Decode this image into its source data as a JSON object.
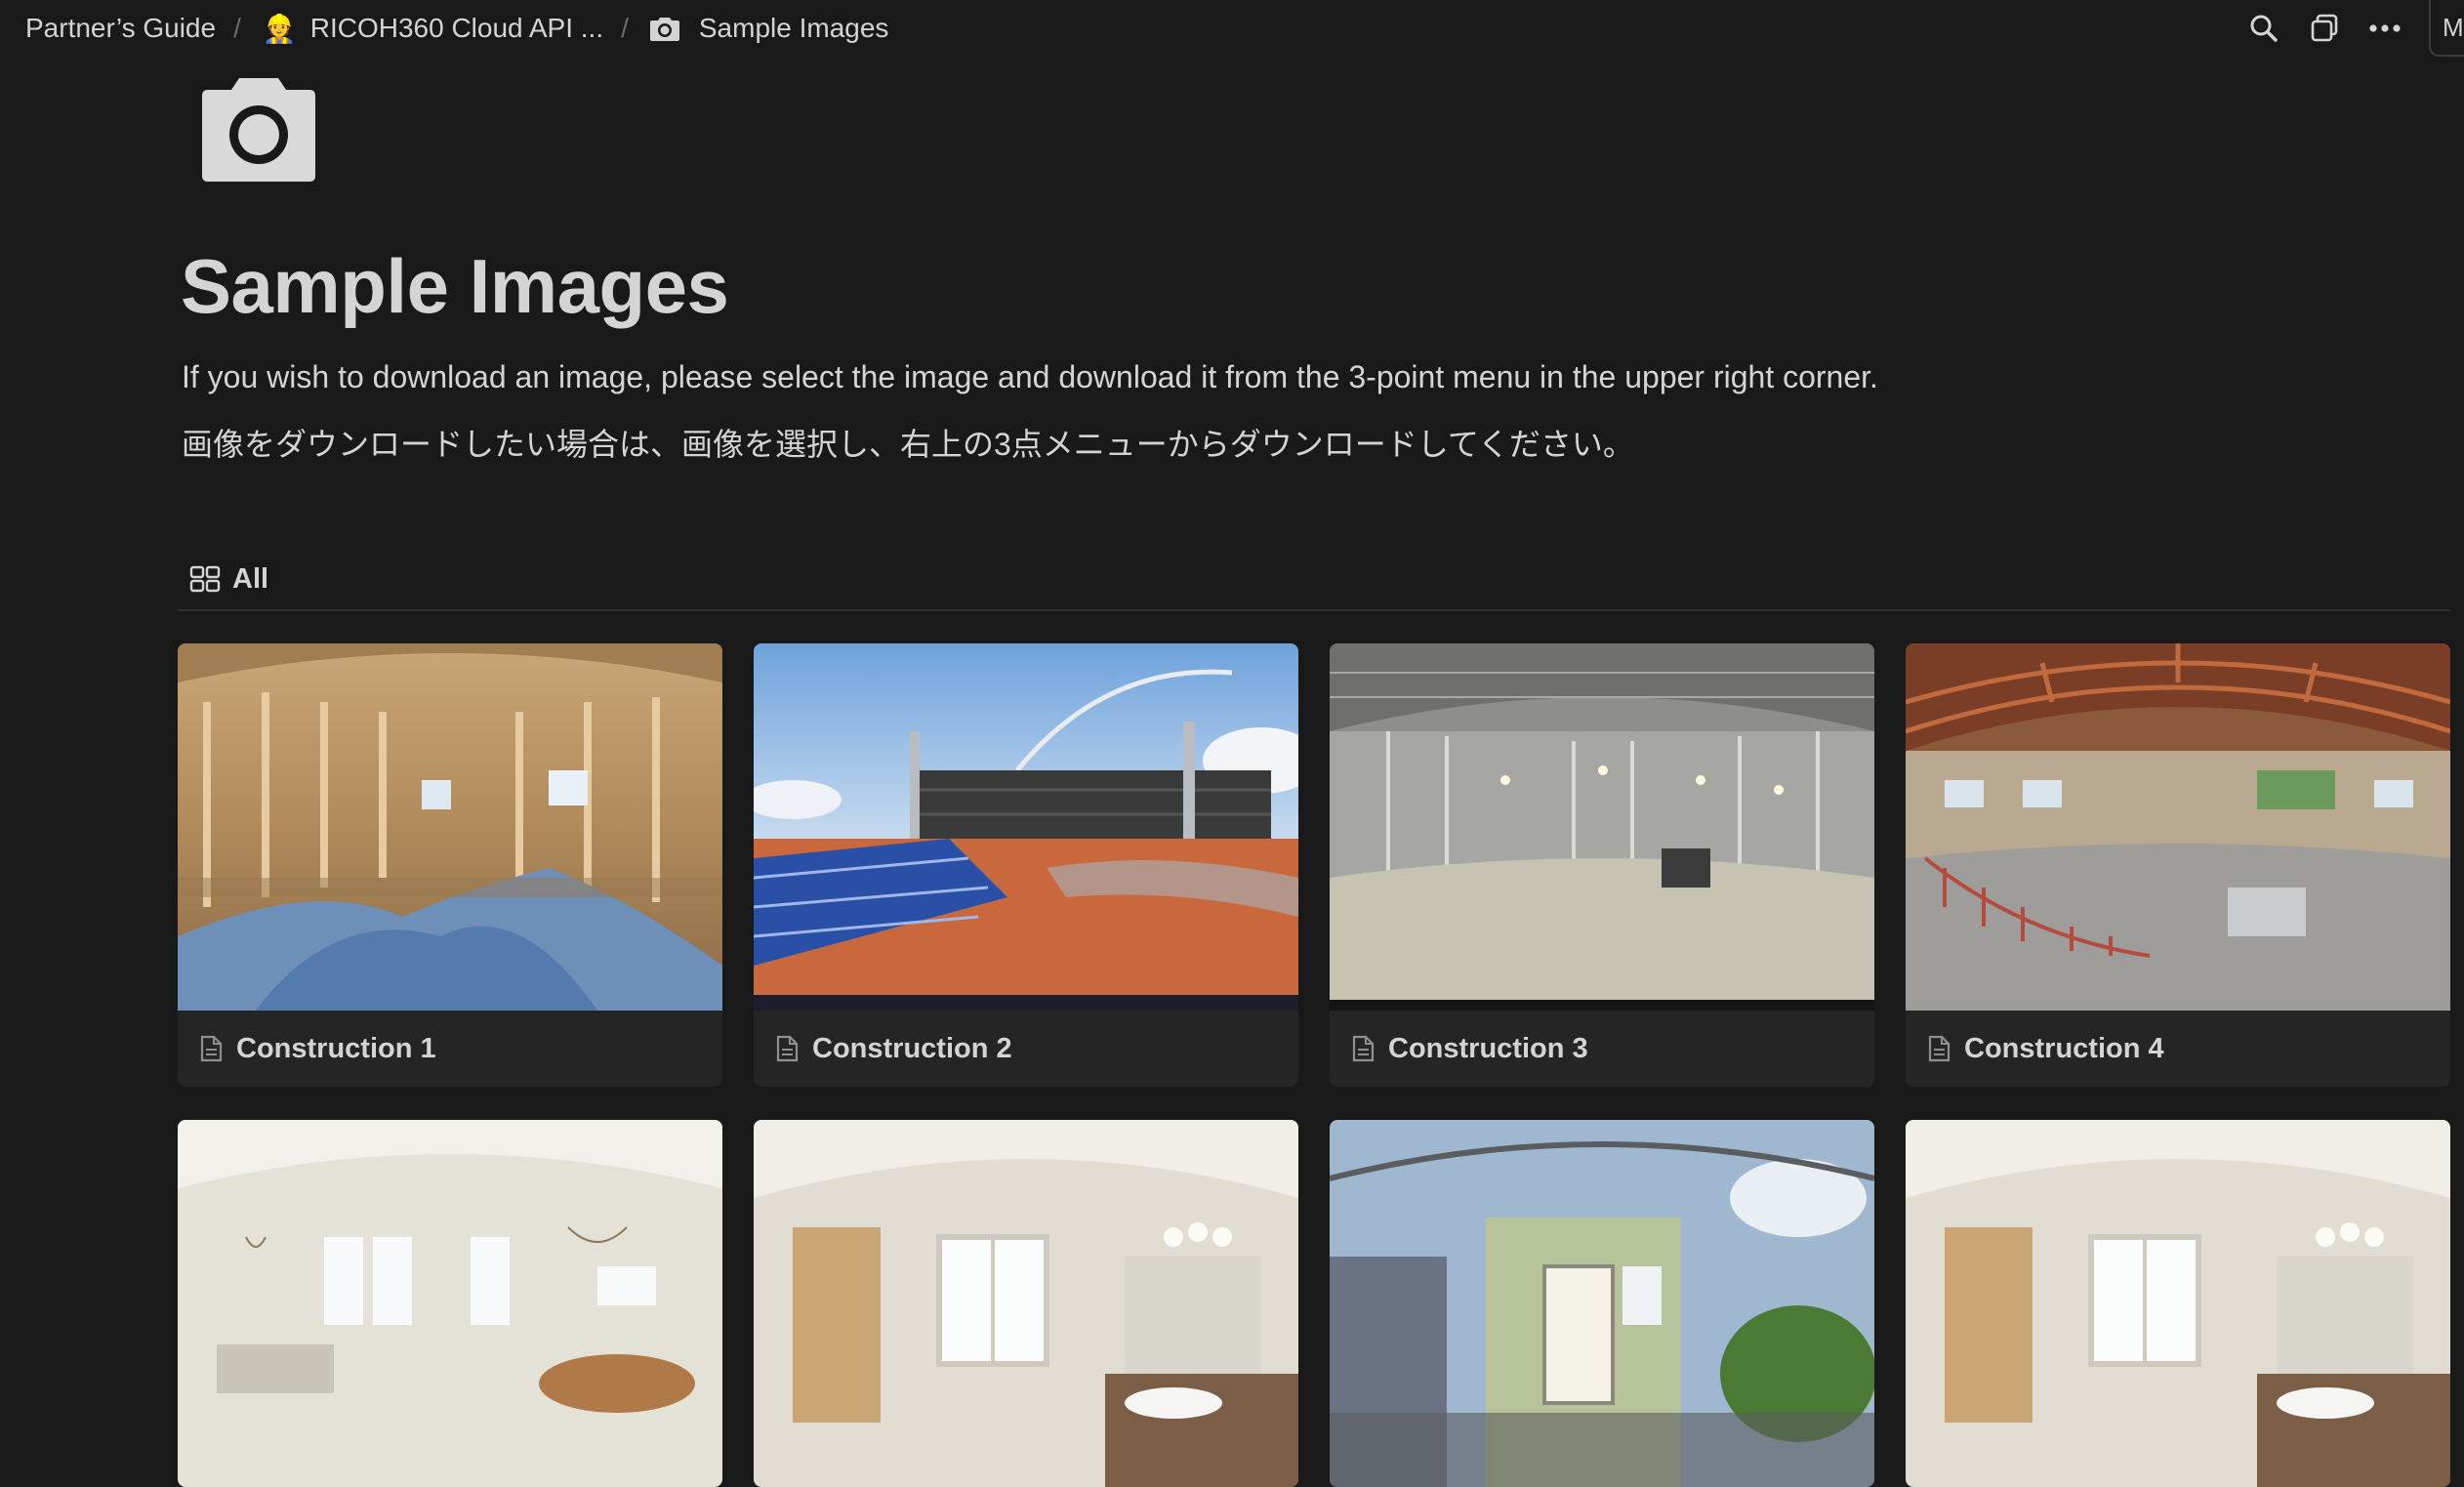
{
  "breadcrumbs": [
    {
      "label": "Partner’s Guide"
    },
    {
      "emoji": "👷",
      "label": "RICOH360 Cloud API ..."
    },
    {
      "label": "Sample Images",
      "icon": "camera-icon"
    }
  ],
  "top_actions": {
    "icons": [
      "search-icon",
      "duplicate-icon",
      "more-icon"
    ],
    "share_stub": "M"
  },
  "page": {
    "icon": "camera-icon",
    "title": "Sample Images",
    "description_en": "If you wish to download an image, please select the image and download it from the 3-point menu in the upper right corner.",
    "description_ja": "画像をダウンロードしたい場合は、画像を選択し、右上の3点メニューからダウンロードしてください。"
  },
  "view": {
    "tab_label": "All",
    "tab_icon": "gallery-icon"
  },
  "gallery": {
    "cards": [
      {
        "title": "Construction 1",
        "scene": "wood-frame interior"
      },
      {
        "title": "Construction 2",
        "scene": "outdoor site"
      },
      {
        "title": "Construction 3",
        "scene": "steel-frame interior"
      },
      {
        "title": "Construction 4",
        "scene": "warehouse interior"
      }
    ],
    "row2": [
      {
        "scene": "living room"
      },
      {
        "scene": "bathroom"
      },
      {
        "scene": "balcony"
      },
      {
        "scene": "bathroom"
      }
    ]
  },
  "colors": {
    "background": "#191919",
    "card": "#252525",
    "text": "#d4d4d4",
    "muted": "#6b6b6b"
  }
}
